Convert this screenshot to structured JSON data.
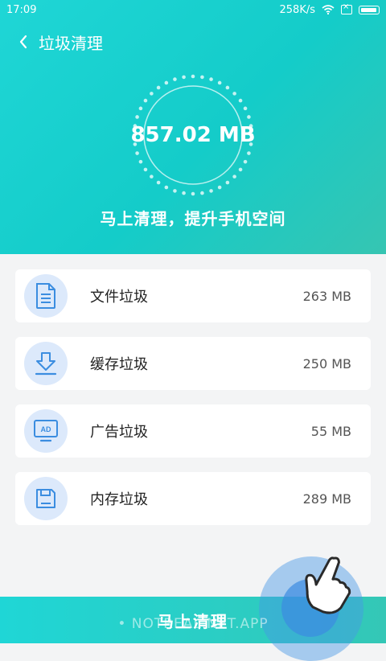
{
  "status_bar": {
    "time": "17:09",
    "net_speed": "258K/s"
  },
  "header": {
    "title": "垃圾清理"
  },
  "summary": {
    "total_size": "857.02 MB",
    "tagline": "马上清理，提升手机空间"
  },
  "items": [
    {
      "label": "文件垃圾",
      "size": "263 MB",
      "icon": "document-icon"
    },
    {
      "label": "缓存垃圾",
      "size": "250 MB",
      "icon": "download-icon"
    },
    {
      "label": "广告垃圾",
      "size": "55 MB",
      "icon": "ad-monitor-icon"
    },
    {
      "label": "内存垃圾",
      "size": "289 MB",
      "icon": "floppy-disk-icon"
    }
  ],
  "action": {
    "clean_label": "马上清理"
  },
  "watermark": "• NOTREAL.NET.APP",
  "colors": {
    "accent": "#1fd6d6",
    "icon_blue": "#3b8de0",
    "icon_bg": "#dce9fb"
  }
}
